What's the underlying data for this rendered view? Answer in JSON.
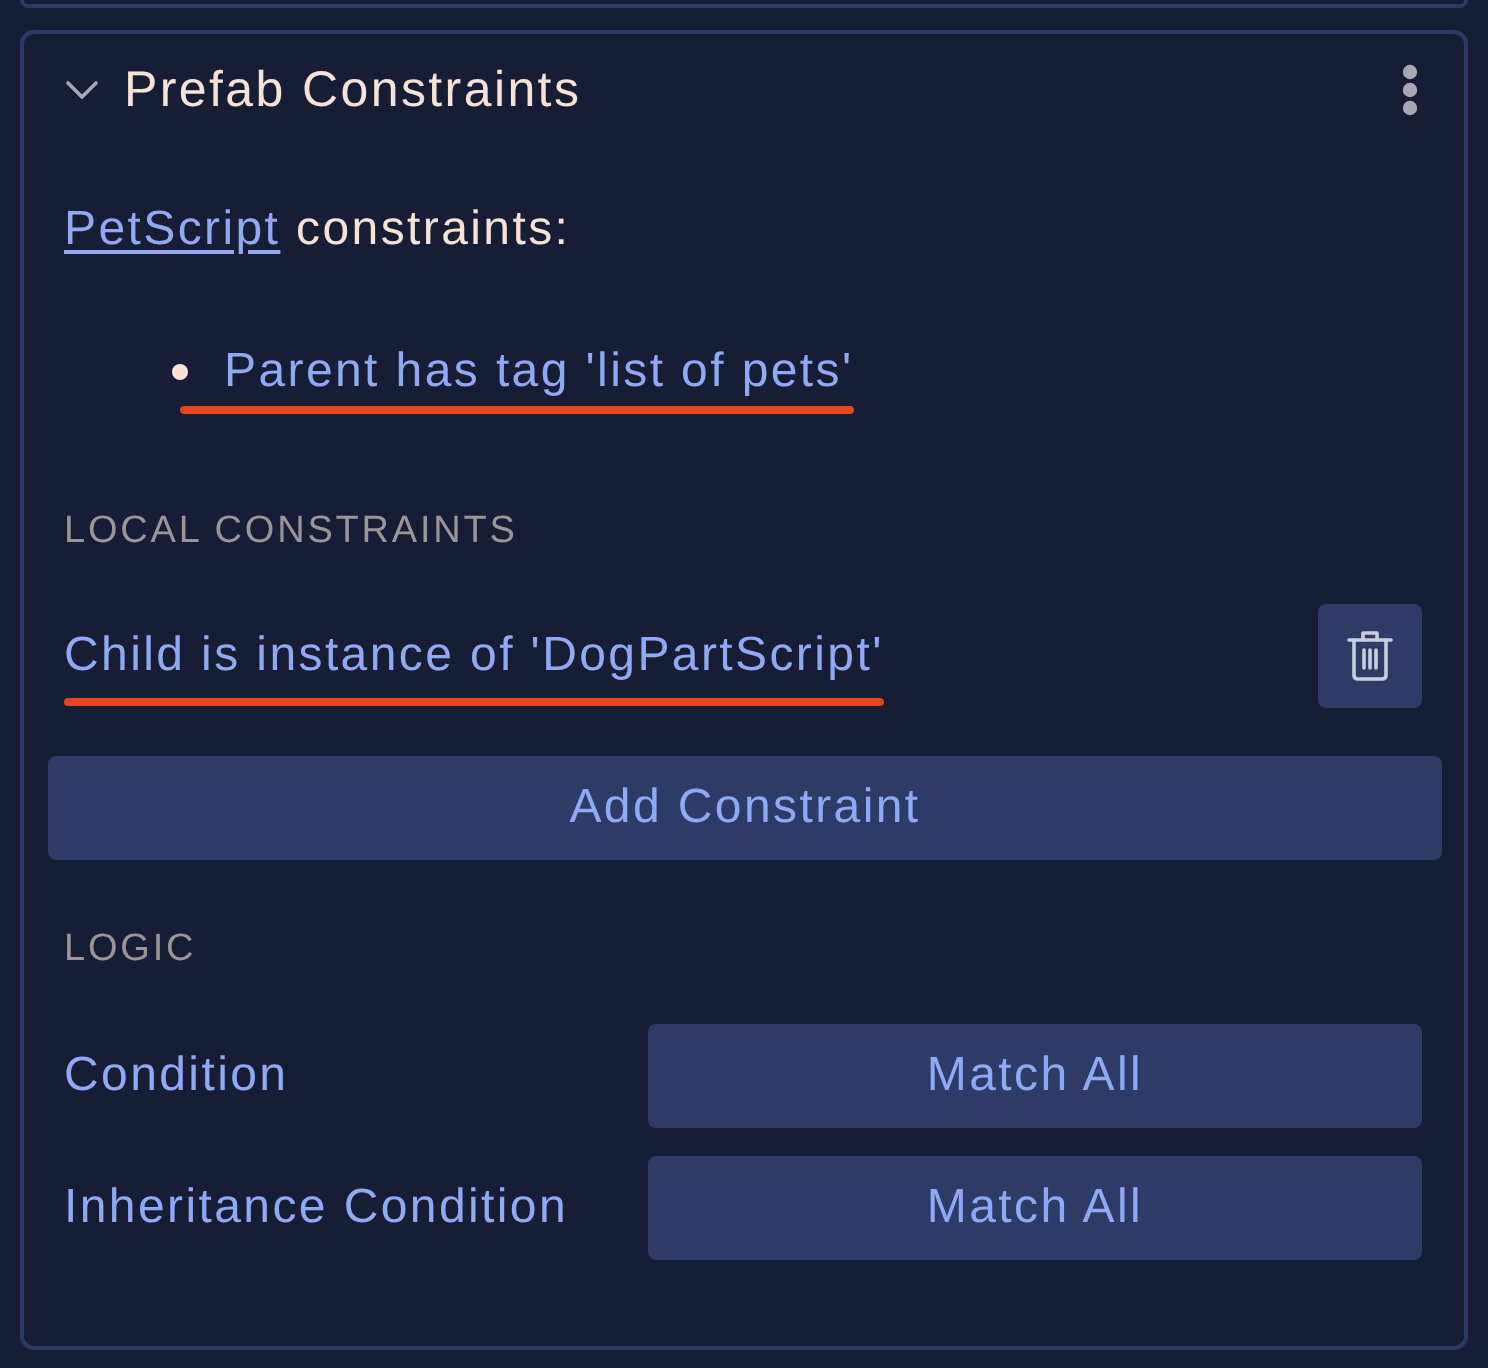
{
  "panel": {
    "title": "Prefab Constraints",
    "expanded": true
  },
  "inherited": {
    "script_link": "PetScript",
    "suffix": "constraints:",
    "items": [
      {
        "text": "Parent has tag 'list of pets'",
        "marked": true
      }
    ]
  },
  "local": {
    "heading": "LOCAL CONSTRAINTS",
    "items": [
      {
        "text": "Child is instance of 'DogPartScript'",
        "marked": true
      }
    ],
    "add_button": "Add Constraint"
  },
  "logic": {
    "heading": "LOGIC",
    "rows": [
      {
        "label": "Condition",
        "value": "Match All"
      },
      {
        "label": "Inheritance Condition",
        "value": "Match All"
      }
    ]
  }
}
